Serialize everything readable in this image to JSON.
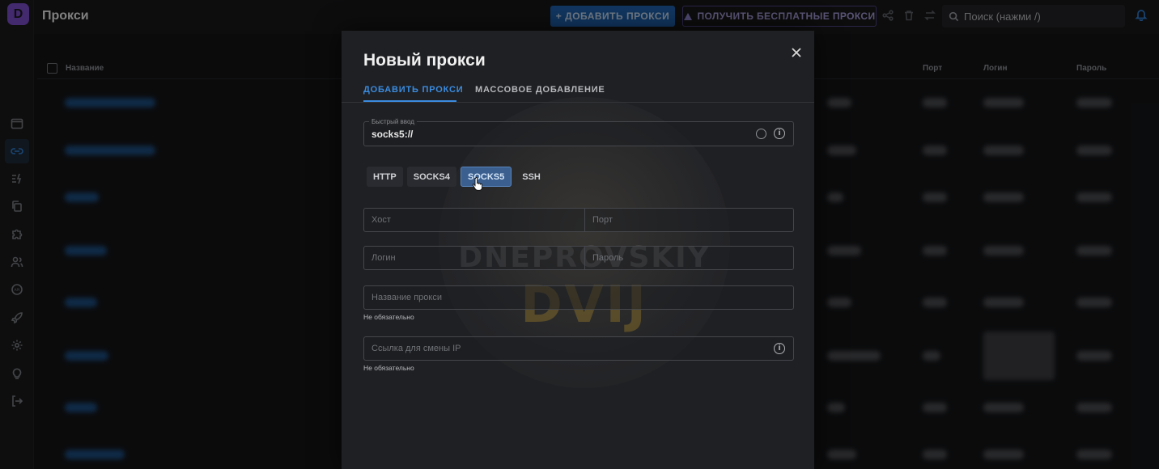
{
  "app": {
    "page_title": "Прокси",
    "logo_letter": "D",
    "accent": "#2f7fd3"
  },
  "toolbar": {
    "add_label": "ДОБАВИТЬ ПРОКСИ",
    "free_label": "ПОЛУЧИТЬ БЕСПЛАТНЫЕ ПРОКСИ",
    "search_placeholder": "Поиск (нажми /)",
    "icons": [
      "share-icon",
      "trash-icon",
      "swap-icon",
      "search-icon",
      "bell-icon"
    ]
  },
  "sidebar": {
    "items": [
      {
        "icon": "browser-icon"
      },
      {
        "icon": "proxy-link-icon",
        "active": true
      },
      {
        "icon": "lightning-icon"
      },
      {
        "icon": "copy-icon"
      },
      {
        "icon": "puzzle-icon"
      },
      {
        "icon": "users-icon"
      },
      {
        "icon": "api-icon"
      },
      {
        "icon": "rocket-icon"
      },
      {
        "icon": "settings-icon"
      },
      {
        "icon": "bulb-icon"
      },
      {
        "icon": "logout-icon"
      }
    ]
  },
  "table": {
    "columns": {
      "name": "Название",
      "port": "Порт",
      "login": "Логин",
      "password": "Пароль"
    }
  },
  "modal": {
    "title": "Новый прокси",
    "tabs": [
      {
        "label": "ДОБАВИТЬ ПРОКСИ",
        "active": true
      },
      {
        "label": "МАССОВОЕ ДОБАВЛЕНИЕ",
        "active": false
      }
    ],
    "quick_input": {
      "legend": "Быстрый ввод",
      "value": "socks5://"
    },
    "protocols": [
      {
        "label": "HTTP",
        "selected": false
      },
      {
        "label": "SOCKS4",
        "selected": false
      },
      {
        "label": "SOCKS5",
        "selected": true
      },
      {
        "label": "SSH",
        "selected": false
      }
    ],
    "fields": {
      "host_placeholder": "Хост",
      "port_placeholder": "Порт",
      "login_placeholder": "Логин",
      "password_placeholder": "Пароль",
      "name_placeholder": "Название прокси",
      "name_hint": "Не обязательно",
      "change_ip_placeholder": "Ссылка для смены IP",
      "change_ip_hint": "Не обязательно"
    },
    "watermark": {
      "line1": "DNEPROVSKIY",
      "line2": "DVIJ"
    }
  }
}
